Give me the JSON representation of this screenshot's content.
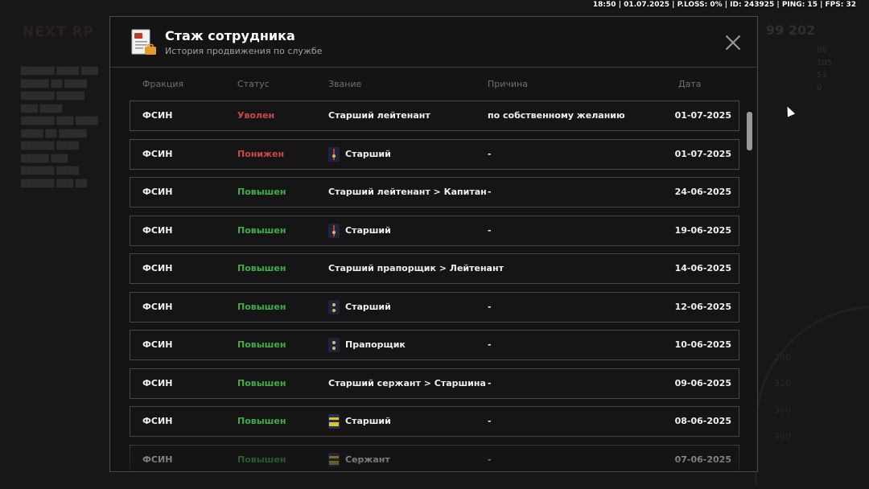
{
  "hud": {
    "stats_line": "18:50 | 01.07.2025 | P.LOSS: 0% | ID: 243925 | PING: 15 | FPS: 32"
  },
  "modal": {
    "title": "Стаж сотрудника",
    "subtitle": "История продвижения по службе",
    "columns": {
      "faction": "Фракция",
      "status": "Статус",
      "rank": "Звание",
      "reason": "Причина",
      "date": "Дата"
    },
    "rows": [
      {
        "faction": "ФСИН",
        "status": "Уволен",
        "status_color": "red",
        "rank": "Старший лейтенант",
        "rank_icon": "",
        "reason": "по собственному желанию",
        "date": "01-07-2025"
      },
      {
        "faction": "ФСИН",
        "status": "Понижен",
        "status_color": "red",
        "rank": "Старший",
        "rank_icon": "strap-dark",
        "reason": "-",
        "date": "01-07-2025"
      },
      {
        "faction": "ФСИН",
        "status": "Повышен",
        "status_color": "green",
        "rank": "Старший лейтенант > Капитан",
        "rank_icon": "",
        "reason": "-",
        "date": "24-06-2025"
      },
      {
        "faction": "ФСИН",
        "status": "Повышен",
        "status_color": "green",
        "rank": "Старший",
        "rank_icon": "strap-dark",
        "reason": "-",
        "date": "19-06-2025"
      },
      {
        "faction": "ФСИН",
        "status": "Повышен",
        "status_color": "green",
        "rank": "Старший прапорщик > Лейтенант",
        "rank_icon": "",
        "reason": "-",
        "date": "14-06-2025"
      },
      {
        "faction": "ФСИН",
        "status": "Повышен",
        "status_color": "green",
        "rank": "Старший",
        "rank_icon": "strap-plain",
        "reason": "-",
        "date": "12-06-2025"
      },
      {
        "faction": "ФСИН",
        "status": "Повышен",
        "status_color": "green",
        "rank": "Прапорщик",
        "rank_icon": "strap-plain",
        "reason": "-",
        "date": "10-06-2025"
      },
      {
        "faction": "ФСИН",
        "status": "Повышен",
        "status_color": "green",
        "rank": "Старший сержант > Старшина",
        "rank_icon": "",
        "reason": "-",
        "date": "09-06-2025"
      },
      {
        "faction": "ФСИН",
        "status": "Повышен",
        "status_color": "green",
        "rank": "Старший",
        "rank_icon": "strap-gold",
        "reason": "-",
        "date": "08-06-2025"
      },
      {
        "faction": "ФСИН",
        "status": "Повышен",
        "status_color": "green",
        "rank": "Сержант",
        "rank_icon": "strap-gold",
        "reason": "-",
        "date": "07-06-2025"
      }
    ]
  },
  "colors": {
    "status_red": "#d04545",
    "status_green": "#3fae48",
    "modal_bg": "#141414"
  }
}
